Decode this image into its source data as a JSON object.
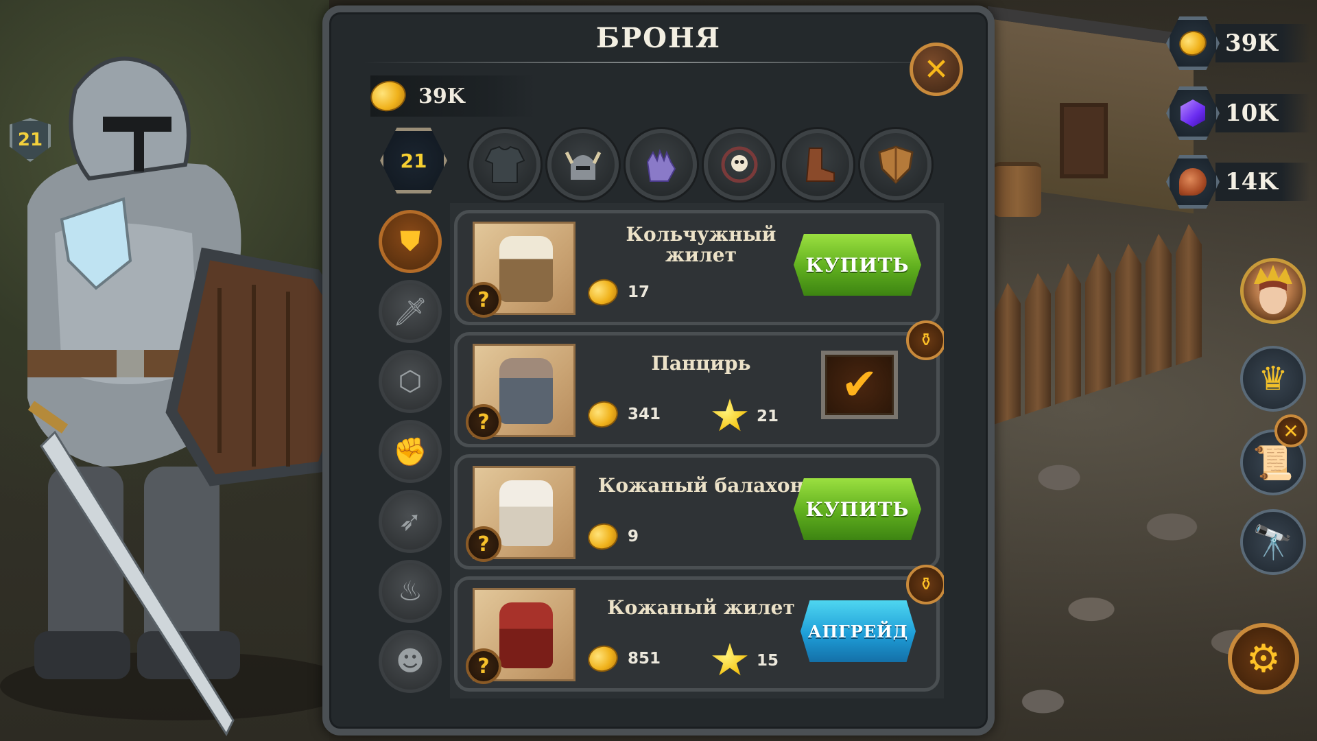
{
  "hud": {
    "hero_level": "21",
    "resources": [
      {
        "icon": "gold-coin-icon",
        "value": "39K"
      },
      {
        "icon": "gem-icon",
        "value": "10K"
      },
      {
        "icon": "meat-icon",
        "value": "14K"
      }
    ]
  },
  "panel": {
    "title": "БРОНЯ",
    "gold": "39K",
    "level": "21",
    "categories": [
      "chest-armor-icon",
      "helmet-icon",
      "gauntlet-icon",
      "amulet-icon",
      "boots-icon",
      "shield-icon"
    ],
    "side_tabs": [
      "shield-icon",
      "sword-icon",
      "hexagon-icon",
      "fist-icon",
      "feather-icon",
      "flame-icon",
      "hero-icon"
    ],
    "items": [
      {
        "name_line1": "Кольчужный",
        "name_line2": "жилет",
        "price": "17",
        "stars": "",
        "action": "КУПИТЬ",
        "state": "buy"
      },
      {
        "name_line1": "Панцирь",
        "name_line2": "",
        "price": "341",
        "stars": "21",
        "action": "",
        "state": "equipped"
      },
      {
        "name_line1": "Кожаный балахон",
        "name_line2": "",
        "price": "9",
        "stars": "",
        "action": "КУПИТЬ",
        "state": "buy"
      },
      {
        "name_line1": "Кожаный жилет",
        "name_line2": "",
        "price": "851",
        "stars": "15",
        "action": "АПГРЕЙД",
        "state": "upgrade"
      }
    ]
  },
  "colors": {
    "gold": "#f0b21c",
    "buy_green": "#5fae1e",
    "upgrade_blue": "#1e9ed8",
    "accent_orange": "#c98a3b"
  }
}
